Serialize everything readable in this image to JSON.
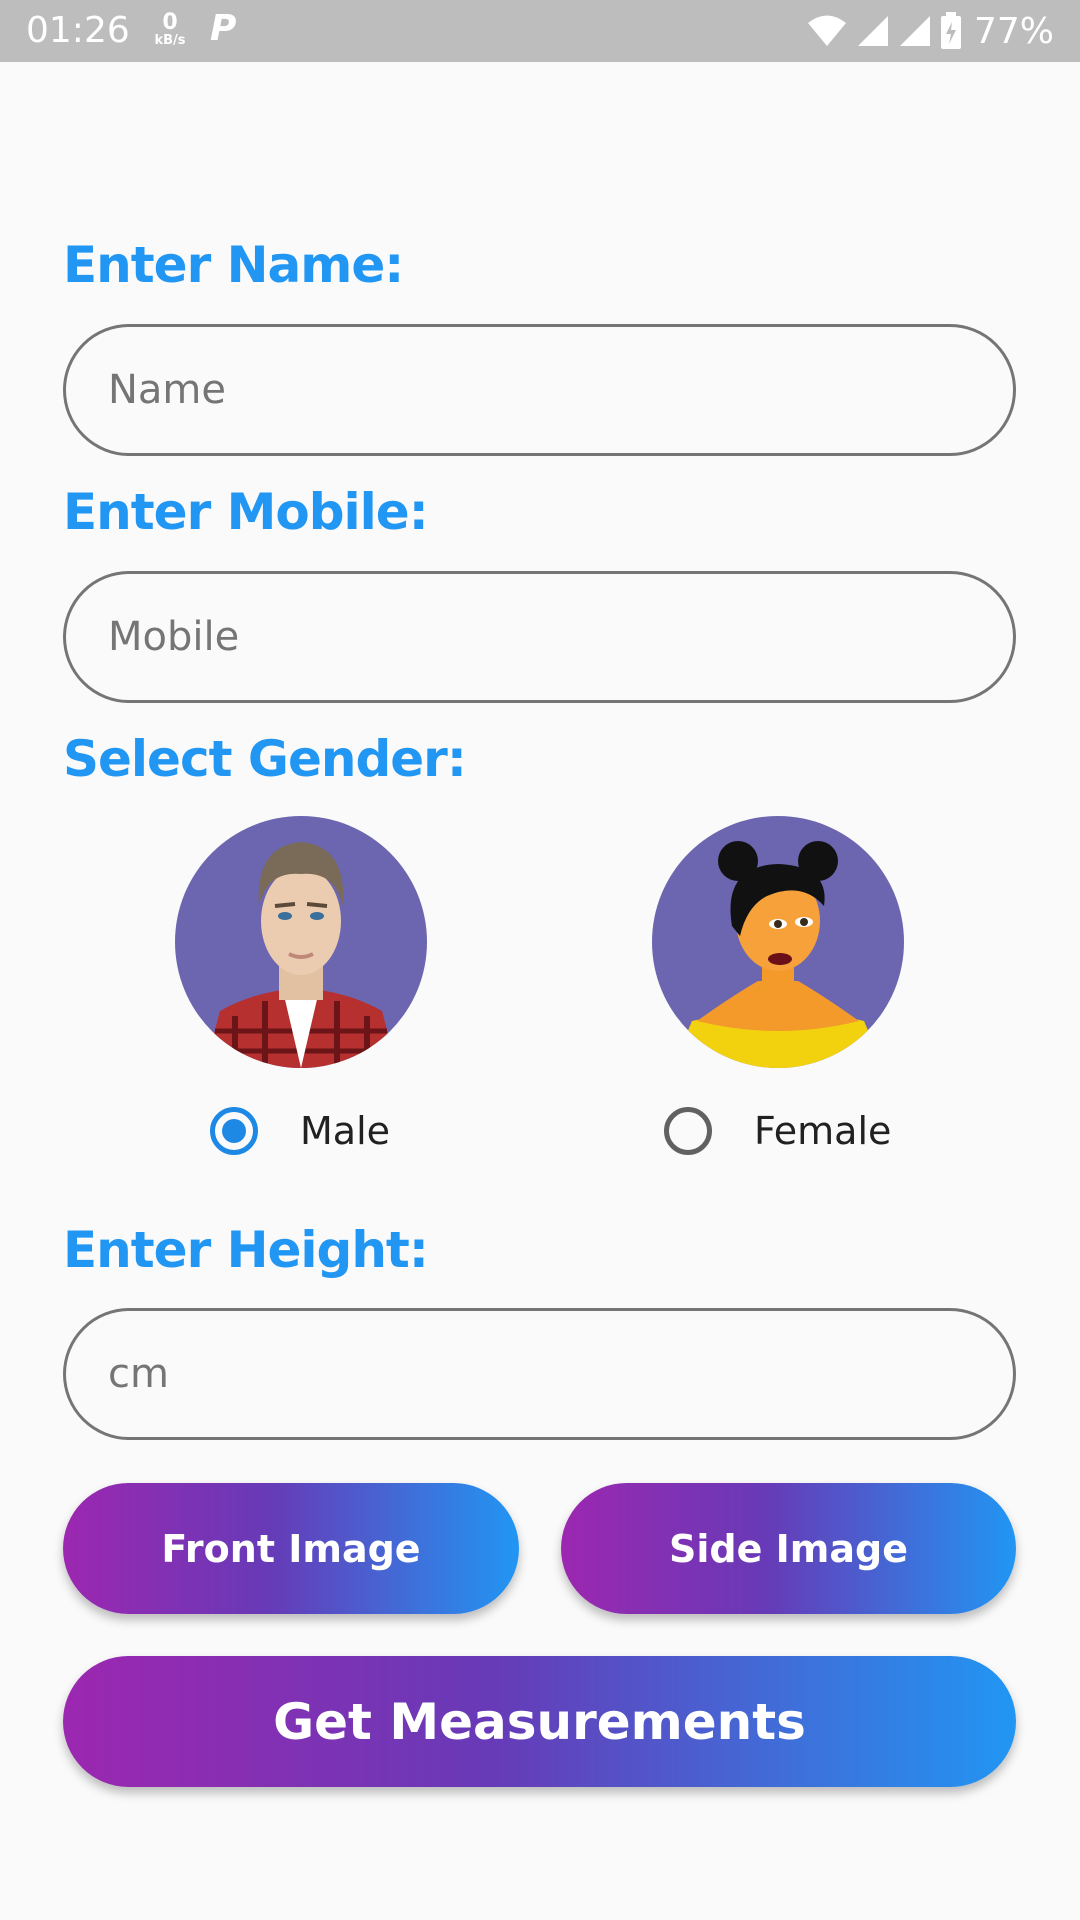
{
  "status_bar": {
    "time": "01:26",
    "net_speed_value": "0",
    "net_speed_unit": "kB/s",
    "app_icon_letter": "P",
    "battery": "77%"
  },
  "form": {
    "name_label": "Enter Name:",
    "name_placeholder": "Name",
    "mobile_label": "Enter Mobile:",
    "mobile_placeholder": "Mobile",
    "gender_label": "Select Gender:",
    "gender_options": [
      {
        "label": "Male",
        "selected": true,
        "avatar": "male-avatar"
      },
      {
        "label": "Female",
        "selected": false,
        "avatar": "female-avatar"
      }
    ],
    "height_label": "Enter Height:",
    "height_placeholder": "cm"
  },
  "buttons": {
    "front_image": "Front Image",
    "side_image": "Side Image",
    "get_measurements": "Get Measurements"
  },
  "colors": {
    "accent": "#2196f3",
    "gradient_start": "#9c27b0",
    "gradient_end": "#2196f3",
    "avatar_bg": "#6c66b0"
  }
}
